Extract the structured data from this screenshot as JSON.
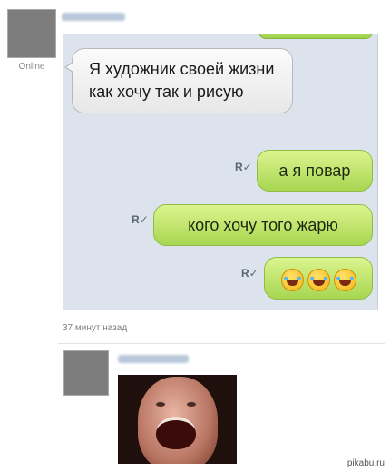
{
  "messages": [
    {
      "direction": "in",
      "text": "Я художник своей жизни как хочу так и рисую"
    },
    {
      "direction": "out",
      "text": "а я повар"
    },
    {
      "direction": "out",
      "text": "кого хочу того жарю"
    },
    {
      "direction": "out",
      "emoji": [
        "face-with-tears-of-joy-icon",
        "face-with-tears-of-joy-icon",
        "face-with-tears-of-joy-icon"
      ]
    }
  ],
  "sender_status": "Online",
  "read_mark": "R",
  "timestamp": "37 минут назад",
  "watermark": "pikabu.ru",
  "colors": {
    "chat_bg": "#dce3ec",
    "incoming_bubble": "#f2f2f2",
    "outgoing_bubble": "#bde46e",
    "avatar": "#7d7d7d"
  }
}
